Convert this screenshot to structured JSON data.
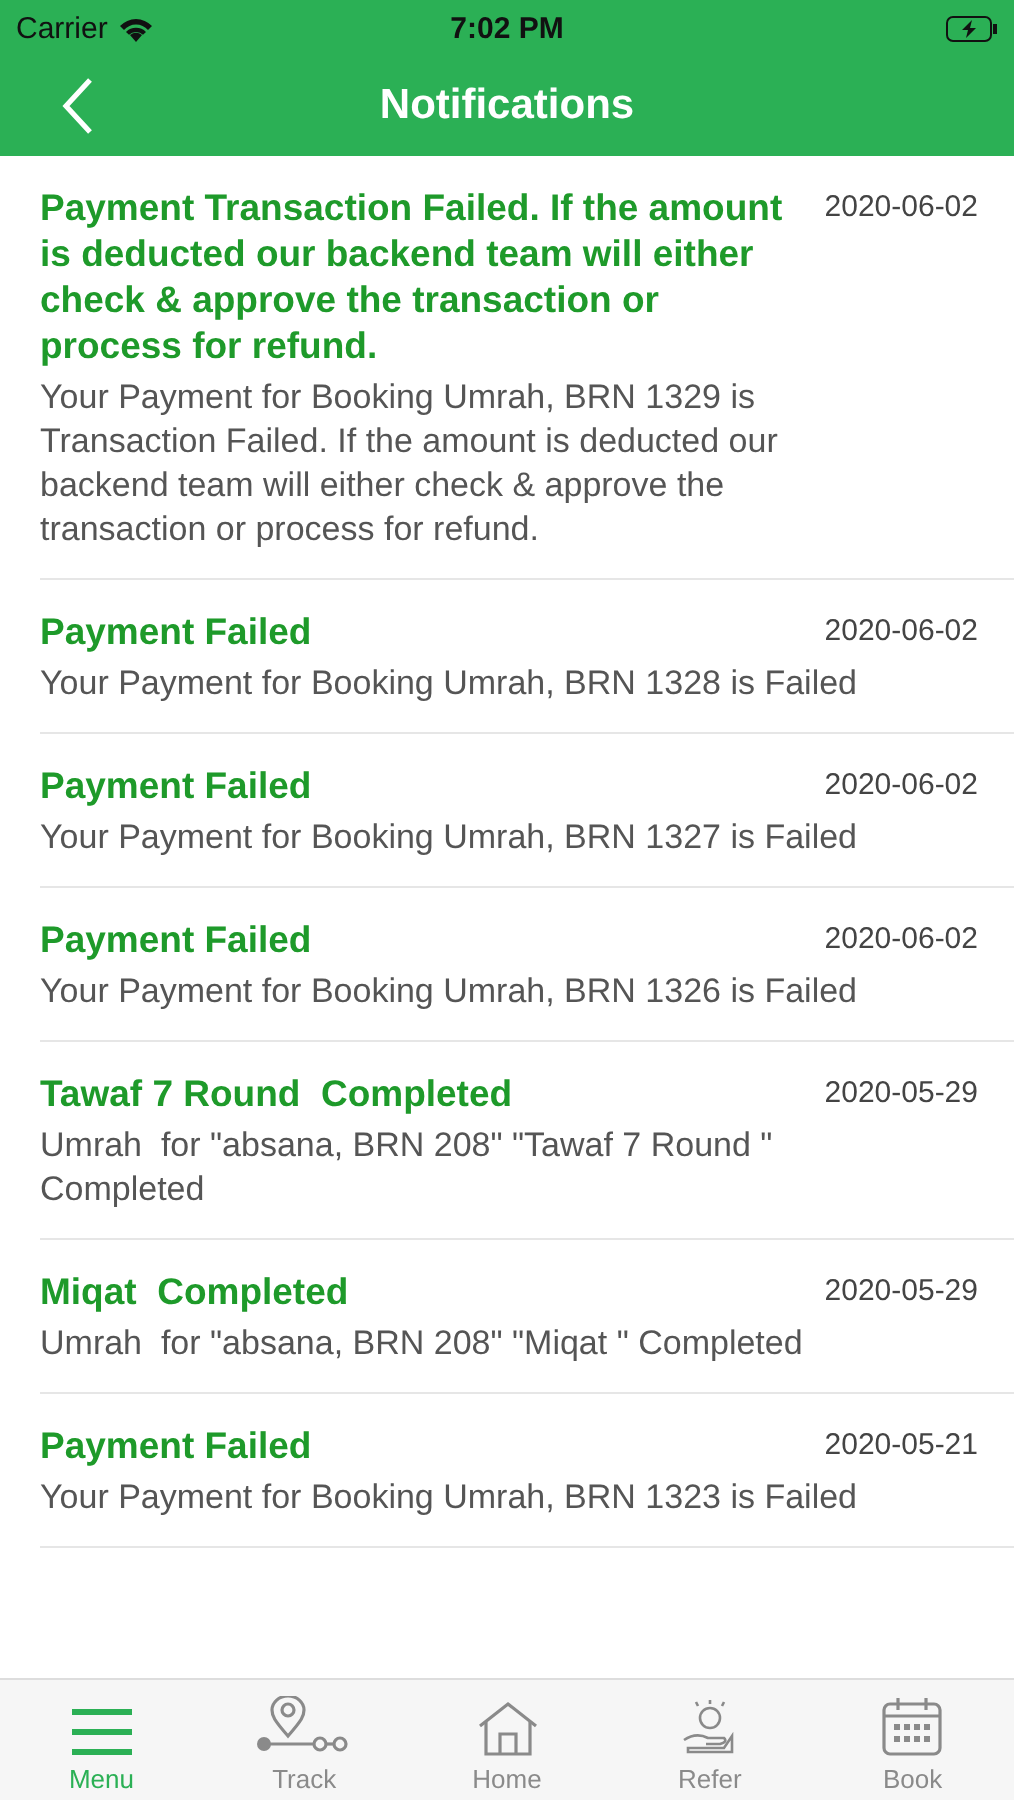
{
  "status_bar": {
    "carrier": "Carrier",
    "time": "7:02 PM"
  },
  "header": {
    "title": "Notifications"
  },
  "notifications": [
    {
      "title": "Payment Transaction Failed. If the amount is deducted our backend team will either check & approve the transaction or process for refund.",
      "date": "2020-06-02",
      "body": "Your Payment for Booking Umrah, BRN 1329 is Transaction Failed. If the amount is deducted our backend team will either check & approve the transaction or process for refund."
    },
    {
      "title": "Payment Failed",
      "date": "2020-06-02",
      "body": "Your Payment for Booking Umrah, BRN 1328 is Failed"
    },
    {
      "title": "Payment Failed",
      "date": "2020-06-02",
      "body": "Your Payment for Booking Umrah, BRN 1327 is Failed"
    },
    {
      "title": "Payment Failed",
      "date": "2020-06-02",
      "body": "Your Payment for Booking Umrah, BRN 1326 is Failed"
    },
    {
      "title": "Tawaf 7 Round  Completed",
      "date": "2020-05-29",
      "body": "Umrah  for \"absana, BRN 208\" \"Tawaf 7 Round \" Completed"
    },
    {
      "title": "Miqat  Completed",
      "date": "2020-05-29",
      "body": "Umrah  for \"absana, BRN 208\" \"Miqat \" Completed"
    },
    {
      "title": "Payment Failed",
      "date": "2020-05-21",
      "body": "Your Payment for Booking Umrah, BRN 1323 is Failed"
    }
  ],
  "tab_bar": [
    {
      "label": "Menu",
      "kind": "menu",
      "selected": true
    },
    {
      "label": "Track",
      "kind": "track",
      "selected": false
    },
    {
      "label": "Home",
      "kind": "home",
      "selected": false
    },
    {
      "label": "Refer",
      "kind": "refer",
      "selected": false
    },
    {
      "label": "Book",
      "kind": "book",
      "selected": false
    }
  ]
}
